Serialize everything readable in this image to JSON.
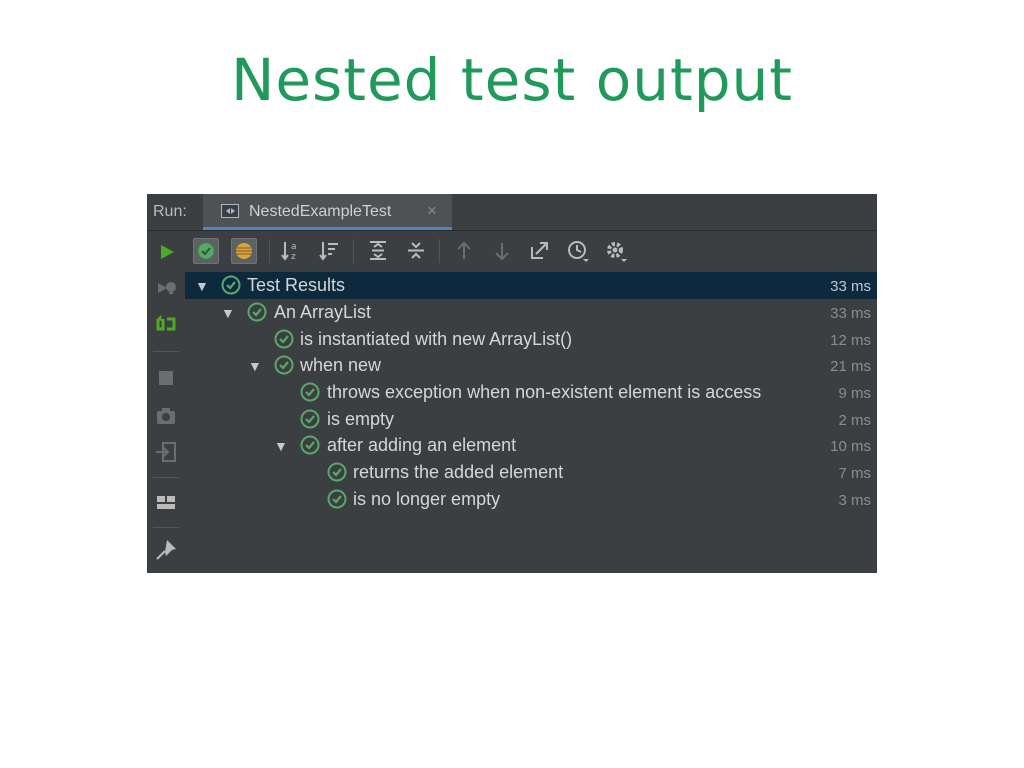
{
  "slide": {
    "title": "Nested test output"
  },
  "run_panel": {
    "label": "Run:",
    "tab": {
      "label": "NestedExampleTest",
      "close_glyph": "×"
    },
    "left_toolbar": [
      "rerun-icon",
      "rerun-failed-icon",
      "toggle-auto-test-icon",
      "stop-icon",
      "screenshot-icon",
      "exit-icon",
      "layout-icon",
      "pin-icon"
    ],
    "top_toolbar": [
      "show-passed-icon",
      "show-ignored-icon",
      "sort-alphabetically-icon",
      "sort-by-duration-icon",
      "expand-all-icon",
      "collapse-all-icon",
      "previous-failed-icon",
      "next-failed-icon",
      "export-icon",
      "history-icon",
      "settings-icon"
    ],
    "tree": [
      {
        "label": "Test Results",
        "time": "33 ms",
        "status": "passed",
        "level": 0,
        "expanded": true,
        "selected": true
      },
      {
        "label": "An ArrayList",
        "time": "33 ms",
        "status": "passed",
        "level": 1,
        "expanded": true
      },
      {
        "label": "is instantiated with new ArrayList()",
        "time": "12 ms",
        "status": "passed",
        "level": 2
      },
      {
        "label": "when new",
        "time": "21 ms",
        "status": "passed",
        "level": 2,
        "expanded": true
      },
      {
        "label": "throws exception when non-existent element is access",
        "time": "9 ms",
        "status": "passed",
        "level": 3
      },
      {
        "label": "is empty",
        "time": "2 ms",
        "status": "passed",
        "level": 3
      },
      {
        "label": "after adding an element",
        "time": "10 ms",
        "status": "passed",
        "level": 3,
        "expanded": true
      },
      {
        "label": "returns the added element",
        "time": "7 ms",
        "status": "passed",
        "level": 4
      },
      {
        "label": "is no longer empty",
        "time": "3 ms",
        "status": "passed",
        "level": 4
      }
    ]
  },
  "colors": {
    "title_green": "#1f9a5a",
    "panel_bg": "#3c3f41",
    "selection_bg": "#0d293e",
    "pass_green": "#59a869",
    "run_green": "#4eaa25"
  }
}
